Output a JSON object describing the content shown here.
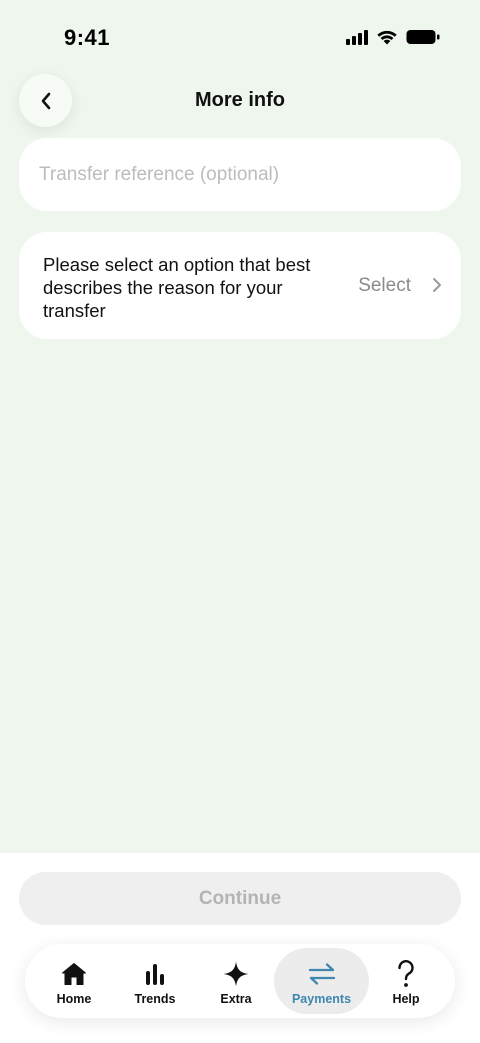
{
  "status_bar": {
    "time": "9:41",
    "icons": [
      "cellular-signal-icon",
      "wifi-icon",
      "battery-icon"
    ]
  },
  "header": {
    "back_icon": "chevron-left-icon",
    "title": "More info"
  },
  "reference_field": {
    "placeholder": "Transfer reference (optional)",
    "value": ""
  },
  "reason_selector": {
    "prompt": "Please select an option that best describes the reason for your transfer",
    "value_label": "Select",
    "chevron_icon": "chevron-right-icon"
  },
  "continue_button": {
    "label": "Continue"
  },
  "tab_bar": {
    "items": [
      {
        "label": "Home",
        "icon": "home-icon"
      },
      {
        "label": "Trends",
        "icon": "bar-chart-icon"
      },
      {
        "label": "Extra",
        "icon": "sparkle-icon"
      },
      {
        "label": "Payments",
        "icon": "transfer-arrows-icon",
        "active": true
      },
      {
        "label": "Help",
        "icon": "question-mark-icon"
      }
    ],
    "active_color": "#3f86b0"
  },
  "colors": {
    "background": "#eef6ee",
    "card": "#ffffff",
    "disabled_button": "#efefef",
    "disabled_text": "#b4b4b4"
  }
}
